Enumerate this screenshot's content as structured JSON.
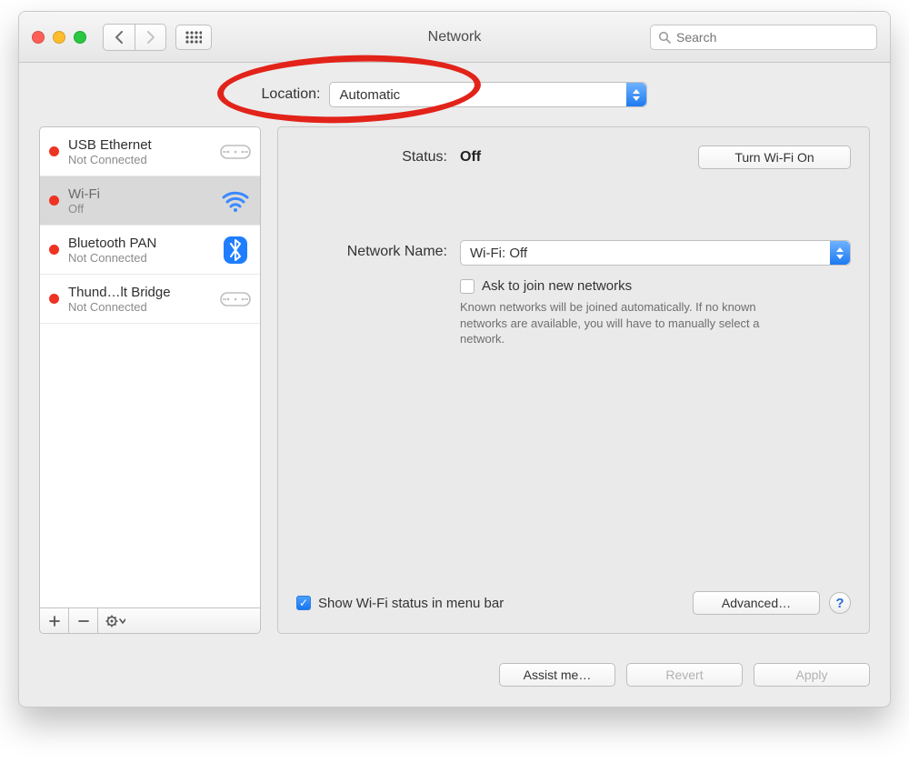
{
  "window": {
    "title": "Network"
  },
  "toolbar": {
    "search_placeholder": "Search"
  },
  "location": {
    "label": "Location:",
    "value": "Automatic"
  },
  "sidebar": {
    "items": [
      {
        "name": "USB Ethernet",
        "sub": "Not Connected",
        "icon": "ethernet",
        "selected": false
      },
      {
        "name": "Wi-Fi",
        "sub": "Off",
        "icon": "wifi",
        "selected": true
      },
      {
        "name": "Bluetooth PAN",
        "sub": "Not Connected",
        "icon": "bluetooth",
        "selected": false
      },
      {
        "name": "Thund…lt Bridge",
        "sub": "Not Connected",
        "icon": "ethernet",
        "selected": false
      }
    ],
    "toolbar": {
      "add": "+",
      "remove": "−",
      "gear": "✱⌄"
    }
  },
  "detail": {
    "status_label": "Status:",
    "status_value": "Off",
    "toggle_button": "Turn Wi-Fi On",
    "network_name_label": "Network Name:",
    "network_name_value": "Wi-Fi: Off",
    "ask_join_label": "Ask to join new networks",
    "ask_join_help": "Known networks will be joined automatically. If no known networks are available, you will have to manually select a network.",
    "ask_join_checked": false,
    "show_status_label": "Show Wi-Fi status in menu bar",
    "show_status_checked": true,
    "advanced_button": "Advanced…",
    "help_glyph": "?"
  },
  "footer": {
    "assist": "Assist me…",
    "revert": "Revert",
    "apply": "Apply"
  }
}
